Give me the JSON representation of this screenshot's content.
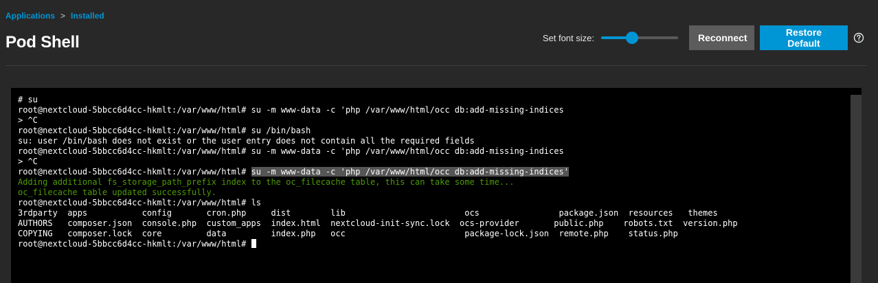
{
  "breadcrumb": {
    "items": [
      "Applications",
      "Installed"
    ],
    "separator": ">"
  },
  "page_title": "Pod Shell",
  "controls": {
    "font_size_label": "Set font size:",
    "font_size_slider_fraction": 0.4,
    "reconnect_label": "Reconnect",
    "restore_default_label": "Restore Default",
    "help_icon": "help-circle-icon"
  },
  "colors": {
    "accent": "#0095d5",
    "background": "#282828",
    "terminal_bg": "#000000",
    "terminal_green": "#4e9a06",
    "secondary_button": "#5c5c5c"
  },
  "terminal": {
    "prompt": "root@nextcloud-5bbcc6d4cc-hkmlt:/var/www/html# ",
    "lines": [
      "# su",
      "root@nextcloud-5bbcc6d4cc-hkmlt:/var/www/html# su -m www-data -c 'php /var/www/html/occ db:add-missing-indices",
      "> ^C",
      "root@nextcloud-5bbcc6d4cc-hkmlt:/var/www/html# su /bin/bash",
      "su: user /bin/bash does not exist or the user entry does not contain all the required fields",
      "root@nextcloud-5bbcc6d4cc-hkmlt:/var/www/html# su -m www-data -c 'php /var/www/html/occ db:add-missing-indices",
      "> ^C"
    ],
    "selected_command": "su -m www-data -c 'php /var/www/html/occ db:add-missing-indices'",
    "green_lines": [
      "Adding additional fs_storage_path_prefix index to the oc_filecache table, this can take some time...",
      "oc_filecache table updated successfully."
    ],
    "ls_command": "ls",
    "ls_rows": [
      "3rdparty  apps           config       cron.php     dist        lib                        ocs                package.json  resources   themes",
      "AUTHORS   composer.json  console.php  custom_apps  index.html  nextcloud-init-sync.lock  ocs-provider       public.php    robots.txt  version.php",
      "COPYING   composer.lock  core         data         index.php   occ                        package-lock.json  remote.php    status.php"
    ]
  }
}
